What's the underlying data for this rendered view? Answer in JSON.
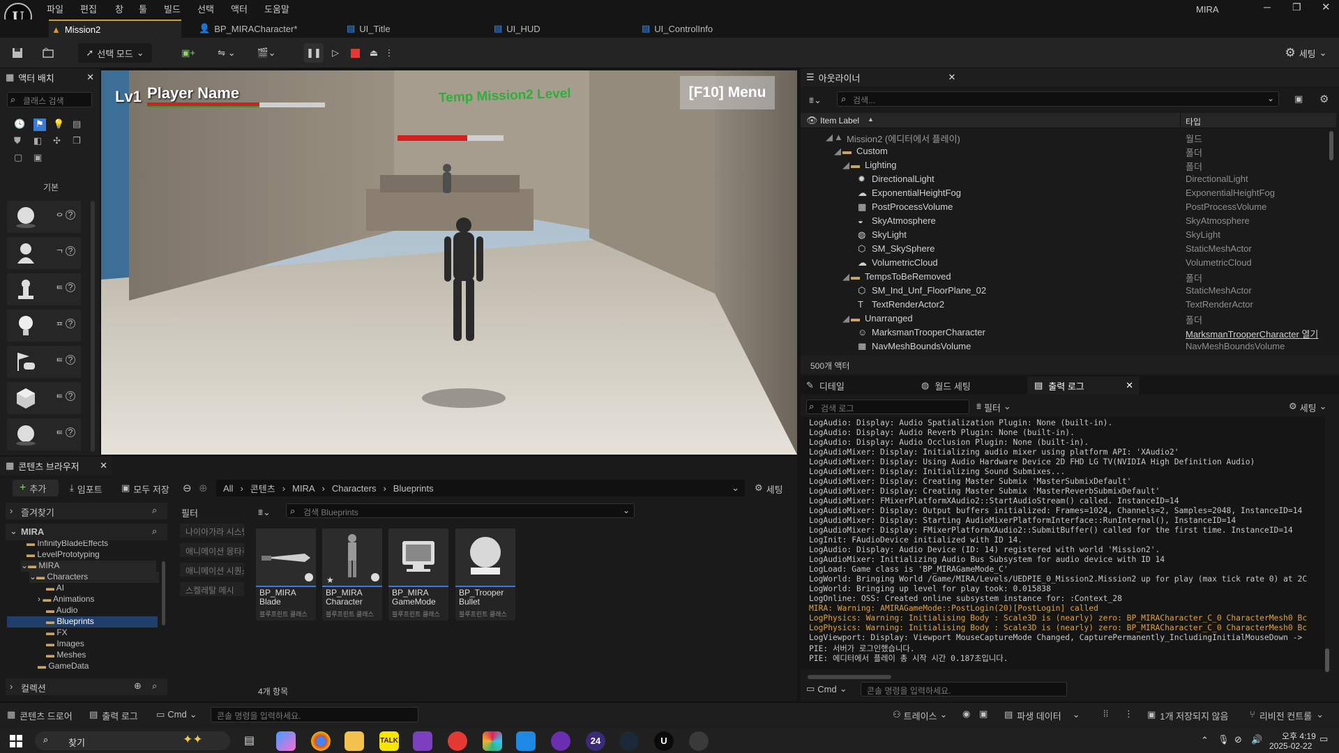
{
  "app": {
    "title": "MIRA"
  },
  "menu": [
    "파일",
    "편집",
    "창",
    "툴",
    "빌드",
    "선택",
    "액터",
    "도움말"
  ],
  "tabs": [
    {
      "label": "Mission2",
      "active": true
    },
    {
      "label": "BP_MIRACharacter*",
      "active": false
    },
    {
      "label": "UI_Title",
      "active": false
    },
    {
      "label": "UI_HUD",
      "active": false
    },
    {
      "label": "UI_ControlInfo",
      "active": false
    }
  ],
  "toolbar": {
    "mode_label": "선택 모드",
    "settings_label": "세팅"
  },
  "place_actors": {
    "title": "액터 배치",
    "search_placeholder": "클래스 검색",
    "category": "기본",
    "items": [
      {
        "icon": "sphere-icon",
        "hint": "ᄋ"
      },
      {
        "icon": "character-icon",
        "hint": "ᄀ"
      },
      {
        "icon": "pawn-icon",
        "hint": "ᄐ"
      },
      {
        "icon": "light-icon",
        "hint": "ᄑ"
      },
      {
        "icon": "player-start-icon",
        "hint": "ᄐ"
      },
      {
        "icon": "cube-icon",
        "hint": "ᄐ"
      },
      {
        "icon": "sphere-icon",
        "hint": "ᄐ"
      }
    ]
  },
  "hud": {
    "level": "Lv1",
    "player_name": "Player Name",
    "health_fraction": 0.63,
    "mission_title": "Temp Mission2 Level",
    "menu_hint": "[F10] Menu",
    "enemy_health_fraction": 0.66
  },
  "outliner": {
    "title": "아웃라이너",
    "search_placeholder": "검색...",
    "col_label": "Item Label",
    "col_type": "타입",
    "rows": [
      {
        "label": "Mission2 (에디터에서 플레이)",
        "type": "월드",
        "depth": 0,
        "kind": "world"
      },
      {
        "label": "Custom",
        "type": "폴더",
        "depth": 1,
        "kind": "folder"
      },
      {
        "label": "Lighting",
        "type": "폴더",
        "depth": 2,
        "kind": "folder"
      },
      {
        "label": "DirectionalLight",
        "type": "DirectionalLight",
        "depth": 3,
        "kind": "actor"
      },
      {
        "label": "ExponentialHeightFog",
        "type": "ExponentialHeightFog",
        "depth": 3,
        "kind": "actor"
      },
      {
        "label": "PostProcessVolume",
        "type": "PostProcessVolume",
        "depth": 3,
        "kind": "actor"
      },
      {
        "label": "SkyAtmosphere",
        "type": "SkyAtmosphere",
        "depth": 3,
        "kind": "actor"
      },
      {
        "label": "SkyLight",
        "type": "SkyLight",
        "depth": 3,
        "kind": "actor"
      },
      {
        "label": "SM_SkySphere",
        "type": "StaticMeshActor",
        "depth": 3,
        "kind": "actor"
      },
      {
        "label": "VolumetricCloud",
        "type": "VolumetricCloud",
        "depth": 3,
        "kind": "actor"
      },
      {
        "label": "TempsToBeRemoved",
        "type": "폴더",
        "depth": 2,
        "kind": "folder"
      },
      {
        "label": "SM_Ind_Unf_FloorPlane_02",
        "type": "StaticMeshActor",
        "depth": 3,
        "kind": "actor"
      },
      {
        "label": "TextRenderActor2",
        "type": "TextRenderActor",
        "depth": 3,
        "kind": "actor"
      },
      {
        "label": "Unarranged",
        "type": "폴더",
        "depth": 2,
        "kind": "folder"
      },
      {
        "label": "MarksmanTrooperCharacter",
        "type": "MarksmanTrooperCharacter 열기",
        "depth": 3,
        "kind": "actor"
      },
      {
        "label": "NavMeshBoundsVolume",
        "type": "NavMeshBoundsVolume",
        "depth": 3,
        "kind": "actor"
      }
    ],
    "count": "500개 액터"
  },
  "bottom_tabs": {
    "details": "디테일",
    "world_settings": "월드 세팅",
    "output_log": "출력 로그"
  },
  "log": {
    "search_placeholder": "검색 로그",
    "filter": "필터",
    "settings": "세팅",
    "cmd": "Cmd",
    "cmd_placeholder": "콘솔 명령을 입력하세요.",
    "lines": [
      {
        "text": "LogAudio: Display: Audio Spatialization Plugin: None (built-in).",
        "warn": false
      },
      {
        "text": "LogAudio: Display: Audio Reverb Plugin: None (built-in).",
        "warn": false
      },
      {
        "text": "LogAudio: Display: Audio Occlusion Plugin: None (built-in).",
        "warn": false
      },
      {
        "text": "LogAudioMixer: Display: Initializing audio mixer using platform API: 'XAudio2'",
        "warn": false
      },
      {
        "text": "LogAudioMixer: Display: Using Audio Hardware Device 2D FHD LG TV(NVIDIA High Definition Audio)",
        "warn": false
      },
      {
        "text": "LogAudioMixer: Display: Initializing Sound Submixes...",
        "warn": false
      },
      {
        "text": "LogAudioMixer: Display: Creating Master Submix 'MasterSubmixDefault'",
        "warn": false
      },
      {
        "text": "LogAudioMixer: Display: Creating Master Submix 'MasterReverbSubmixDefault'",
        "warn": false
      },
      {
        "text": "LogAudioMixer: FMixerPlatformXAudio2::StartAudioStream() called. InstanceID=14",
        "warn": false
      },
      {
        "text": "LogAudioMixer: Display: Output buffers initialized: Frames=1024, Channels=2, Samples=2048, InstanceID=14",
        "warn": false
      },
      {
        "text": "LogAudioMixer: Display: Starting AudioMixerPlatformInterface::RunInternal(), InstanceID=14",
        "warn": false
      },
      {
        "text": "LogAudioMixer: Display: FMixerPlatformXAudio2::SubmitBuffer() called for the first time. InstanceID=14",
        "warn": false
      },
      {
        "text": "LogInit: FAudioDevice initialized with ID 14.",
        "warn": false
      },
      {
        "text": "LogAudio: Display: Audio Device (ID: 14) registered with world 'Mission2'.",
        "warn": false
      },
      {
        "text": "LogAudioMixer: Initializing Audio Bus Subsystem for audio device with ID 14",
        "warn": false
      },
      {
        "text": "LogLoad: Game class is 'BP_MIRAGameMode_C'",
        "warn": false
      },
      {
        "text": "LogWorld: Bringing World /Game/MIRA/Levels/UEDPIE_0_Mission2.Mission2 up for play (max tick rate 0) at 2C",
        "warn": false
      },
      {
        "text": "LogWorld: Bringing up level for play took: 0.015838",
        "warn": false
      },
      {
        "text": "LogOnline: OSS: Created online subsystem instance for: :Context_28",
        "warn": false
      },
      {
        "text": "MIRA: Warning: AMIRAGameMode::PostLogin(20)[PostLogin] called",
        "warn": true
      },
      {
        "text": "LogPhysics: Warning: Initialising Body : Scale3D is (nearly) zero: BP_MIRACharacter_C_0 CharacterMesh0 Bc",
        "warn": true
      },
      {
        "text": "LogPhysics: Warning: Initialising Body : Scale3D is (nearly) zero: BP_MIRACharacter_C_0 CharacterMesh0 Bc",
        "warn": true
      },
      {
        "text": "LogViewport: Display: Viewport MouseCaptureMode Changed, CapturePermanently_IncludingInitialMouseDown ->",
        "warn": false
      },
      {
        "text": "PIE: 서버가 로그인했습니다.",
        "warn": false
      },
      {
        "text": "PIE: 에디터에서 플레이 총 시작 시간 0.187초입니다.",
        "warn": false
      }
    ]
  },
  "content_browser": {
    "title": "콘텐츠 브라우저",
    "add": "추가",
    "import": "임포트",
    "save_all": "모두 저장",
    "settings": "세팅",
    "breadcrumb": [
      "All",
      "콘텐츠",
      "MIRA",
      "Characters",
      "Blueprints"
    ],
    "favorites": "즐겨찾기",
    "root": "MIRA",
    "tree": [
      {
        "label": "InfinityBladeEffects",
        "depth": 2
      },
      {
        "label": "LevelPrototyping",
        "depth": 2
      },
      {
        "label": "MIRA",
        "depth": 2
      },
      {
        "label": "Characters",
        "depth": 3
      },
      {
        "label": "AI",
        "depth": 4
      },
      {
        "label": "Animations",
        "depth": 4
      },
      {
        "label": "Audio",
        "depth": 4
      },
      {
        "label": "Blueprints",
        "depth": 4,
        "selected": true
      },
      {
        "label": "FX",
        "depth": 4
      },
      {
        "label": "Images",
        "depth": 4
      },
      {
        "label": "Meshes",
        "depth": 4
      },
      {
        "label": "GameData",
        "depth": 3
      }
    ],
    "collections": "컬렉션",
    "filter_title": "필터",
    "filters": [
      "나이아가라 시스템",
      "애니메이션 몽타주",
      "애니메이션 시퀀스",
      "스켈레탈 메시"
    ],
    "search_placeholder": "검색 Blueprints",
    "assets": [
      {
        "name": "BP_MIRA Blade",
        "sub": "블루프린트 클래스"
      },
      {
        "name": "BP_MIRA Character",
        "sub": "블루프린트 클래스"
      },
      {
        "name": "BP_MIRA GameMode",
        "sub": "블루프린트 클래스"
      },
      {
        "name": "BP_Trooper Bullet",
        "sub": "블루프린트 클래스"
      }
    ],
    "count": "4개 항목"
  },
  "statusbar": {
    "content_drawer": "콘텐츠 드로어",
    "output_log": "출력 로그",
    "cmd": "Cmd",
    "cmd_placeholder": "콘솔 명령을 입력하세요.",
    "trace": "트레이스",
    "derived_data": "파생 데이터",
    "unsaved": "1개 저장되지 않음",
    "revision": "리비전 컨트롤"
  },
  "taskbar": {
    "search": "찾기",
    "time": "오후 4:19",
    "date": "2025-02-22"
  }
}
